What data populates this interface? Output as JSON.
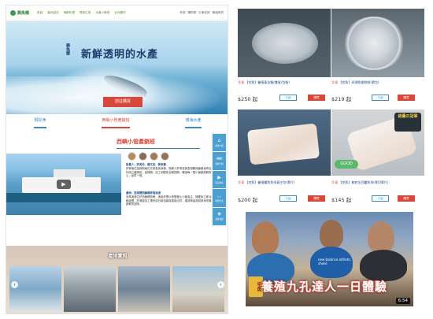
{
  "left_page": {
    "logo": "興魚鄉",
    "nav": [
      "首頁",
      "產地直送",
      "海鮮料理",
      "環境生態",
      "水產小學堂",
      "合作夥伴"
    ],
    "nav_right": [
      "會員",
      "購物車",
      "訂單查詢",
      "聯絡我們"
    ],
    "hero": {
      "title": "新鮮透明的水產",
      "vertical_text": "興魚鄉",
      "button": "前往購買"
    },
    "tabs": [
      "飼好漁",
      "西嶼小管產銷班",
      "博海水產"
    ],
    "section_title": "西嶼小管產銷班",
    "people_text": "負責人：許美玲、陳文宏、郭家豪",
    "people_desc": "許家兩位姐妹與兩位兄弟負責漁事，與鄰人許清泉與澎湖縣西嶼鄉漁會合作成立產銷班，從捕撈、加工到販售全程把關，確保每一尾小管都新鮮安心，品質一致。",
    "place_text": "產地：澎湖縣西嶼鄉赤馬漁港",
    "place_desc": "赤馬漁港位於西嶼鄉西側，漁船作業以夜間燈火小管為主，捕獲後立即冰鮮處理，於港邊加工場完成分級包裝後直接出貨，讓消費者品嚐到海洋最新鮮的滋味。",
    "side_menu": [
      "產地介紹",
      "漁場介紹",
      "影音專區",
      "料理方式",
      "品質保證"
    ],
    "photos_title": "產地實照"
  },
  "products": [
    {
      "tag": "冷凍",
      "name": "【宅魚】養殖黃金鯧(雙尾/包裝)",
      "price": "$250 起",
      "intro": "介紹",
      "buy": "購買"
    },
    {
      "tag": "冷凍",
      "name": "【宅魚】澎湖肥美鮮蚵(單包)",
      "price": "$219 起",
      "intro": "介紹",
      "buy": "購買"
    },
    {
      "tag": "冷凍",
      "name": "【宅魚】養殖鱸魚魚排真空包(單片)",
      "price": "$200 起",
      "intro": "介紹",
      "buy": "購買"
    },
    {
      "tag": "冷凍",
      "name": "【宅魚】無刺金目鱸魚排(厚切單片)",
      "price": "$145 起",
      "intro": "介紹",
      "buy": "購買"
    }
  ],
  "badge_text": "銷量の冠軍",
  "good_badge": "GOOD",
  "video": {
    "caption": "養殖九孔達人一日體驗",
    "logo": "宅魚",
    "duration": "6:54",
    "shirt_text": "new balance athletic shoes"
  }
}
